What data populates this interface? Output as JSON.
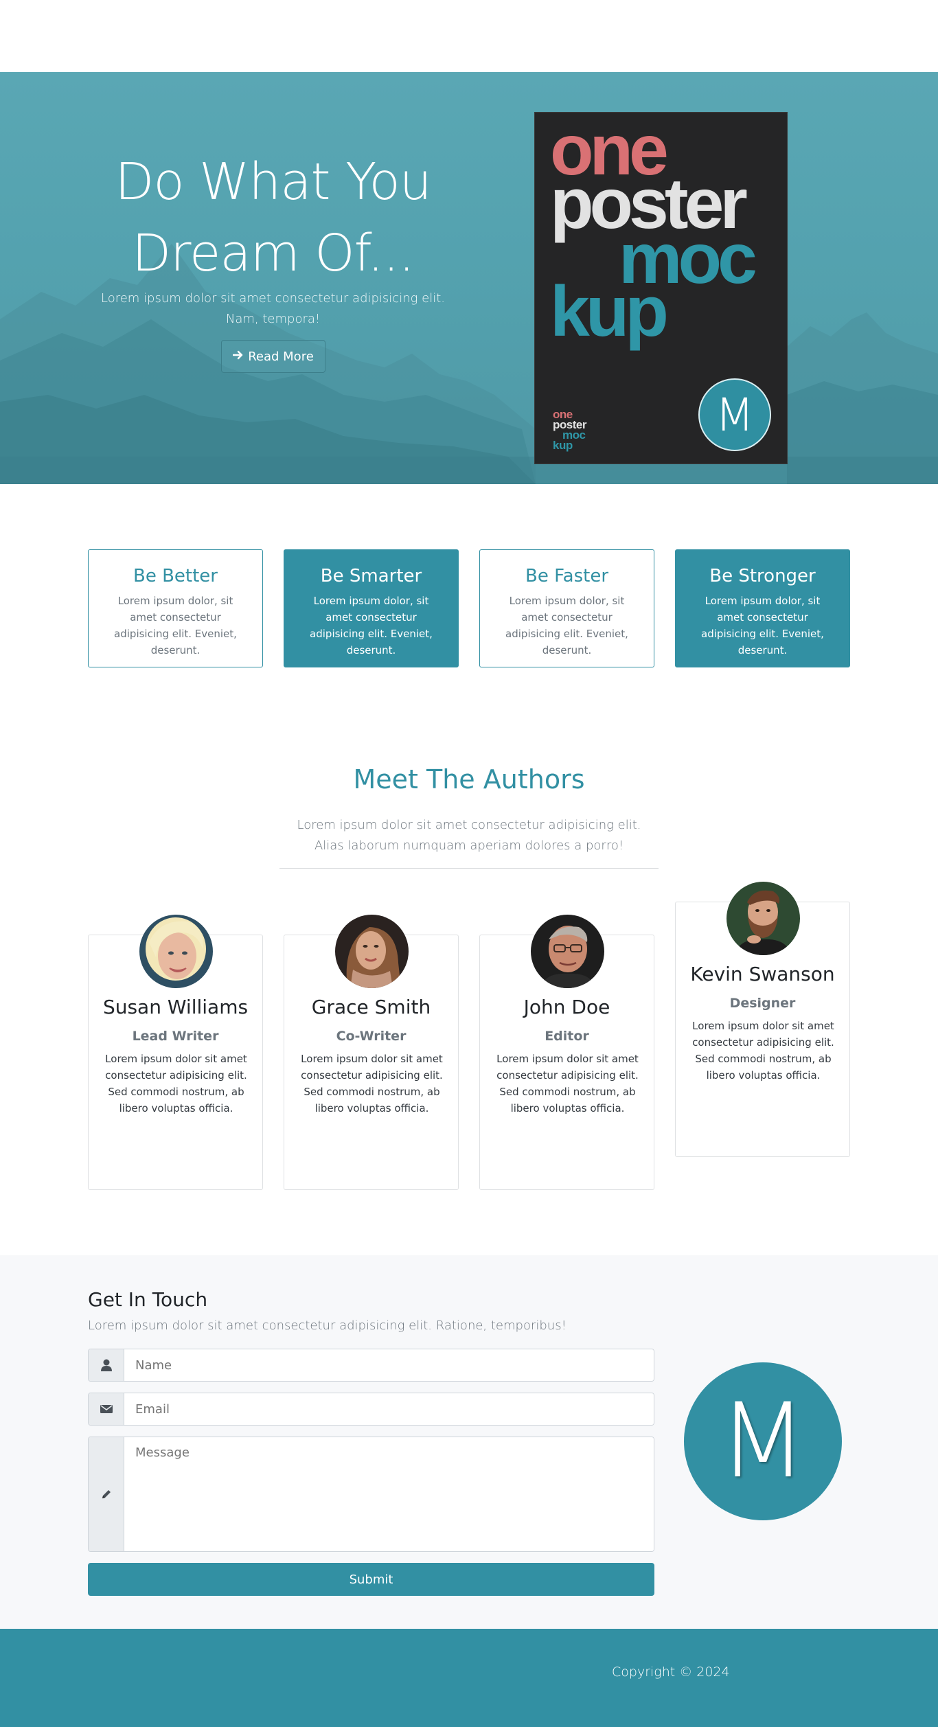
{
  "hero": {
    "title": "Do What You Dream Of...",
    "subtitle": "Lorem ipsum dolor sit amet consectetur adipisicing elit. Nam, tempora!",
    "button_icon": "arrow-right-icon",
    "button_label": "Read More",
    "poster": {
      "words": [
        "one",
        "poster",
        "moc",
        "kup"
      ],
      "logo_letter": "M",
      "colors": {
        "one": "#d97174",
        "poster": "#e2e2e2",
        "mockup": "#2f96a7",
        "background": "#252526"
      }
    },
    "background_color": "#54a2af"
  },
  "features": [
    {
      "title": "Be Better",
      "text": "Lorem ipsum dolor, sit amet consectetur adipisicing elit. Eveniet, deserunt.",
      "style": "outline"
    },
    {
      "title": "Be Smarter",
      "text": "Lorem ipsum dolor, sit amet consectetur adipisicing elit. Eveniet, deserunt.",
      "style": "filled"
    },
    {
      "title": "Be Faster",
      "text": "Lorem ipsum dolor, sit amet consectetur adipisicing elit. Eveniet, deserunt.",
      "style": "outline"
    },
    {
      "title": "Be Stronger",
      "text": "Lorem ipsum dolor, sit amet consectetur adipisicing elit. Eveniet, deserunt.",
      "style": "filled"
    }
  ],
  "authors": {
    "title": "Meet The Authors",
    "subtitle": "Lorem ipsum dolor sit amet consectetur adipisicing elit. Alias laborum numquam aperiam dolores a porro!",
    "items": [
      {
        "name": "Susan Williams",
        "role": "Lead Writer",
        "bio": "Lorem ipsum dolor sit amet consectetur adipisicing elit. Sed commodi nostrum, ab libero voluptas officia."
      },
      {
        "name": "Grace Smith",
        "role": "Co-Writer",
        "bio": "Lorem ipsum dolor sit amet consectetur adipisicing elit. Sed commodi nostrum, ab libero voluptas officia."
      },
      {
        "name": "John Doe",
        "role": "Editor",
        "bio": "Lorem ipsum dolor sit amet consectetur adipisicing elit. Sed commodi nostrum, ab libero voluptas officia."
      },
      {
        "name": "Kevin Swanson",
        "role": "Designer",
        "bio": "Lorem ipsum dolor sit amet consectetur adipisicing elit. Sed commodi nostrum, ab libero voluptas officia."
      }
    ]
  },
  "contact": {
    "title": "Get In Touch",
    "lead": "Lorem ipsum dolor sit amet consectetur adipisicing elit. Ratione, temporibus!",
    "name_placeholder": "Name",
    "name_icon": "user-icon",
    "email_placeholder": "Email",
    "email_icon": "envelope-icon",
    "message_placeholder": "Message",
    "message_icon": "pencil-icon",
    "submit_label": "Submit",
    "logo_letter": "M"
  },
  "footer": {
    "copyright": "Copyright © 2024"
  },
  "colors": {
    "accent": "#3290a3",
    "muted_text": "#6c757d"
  }
}
